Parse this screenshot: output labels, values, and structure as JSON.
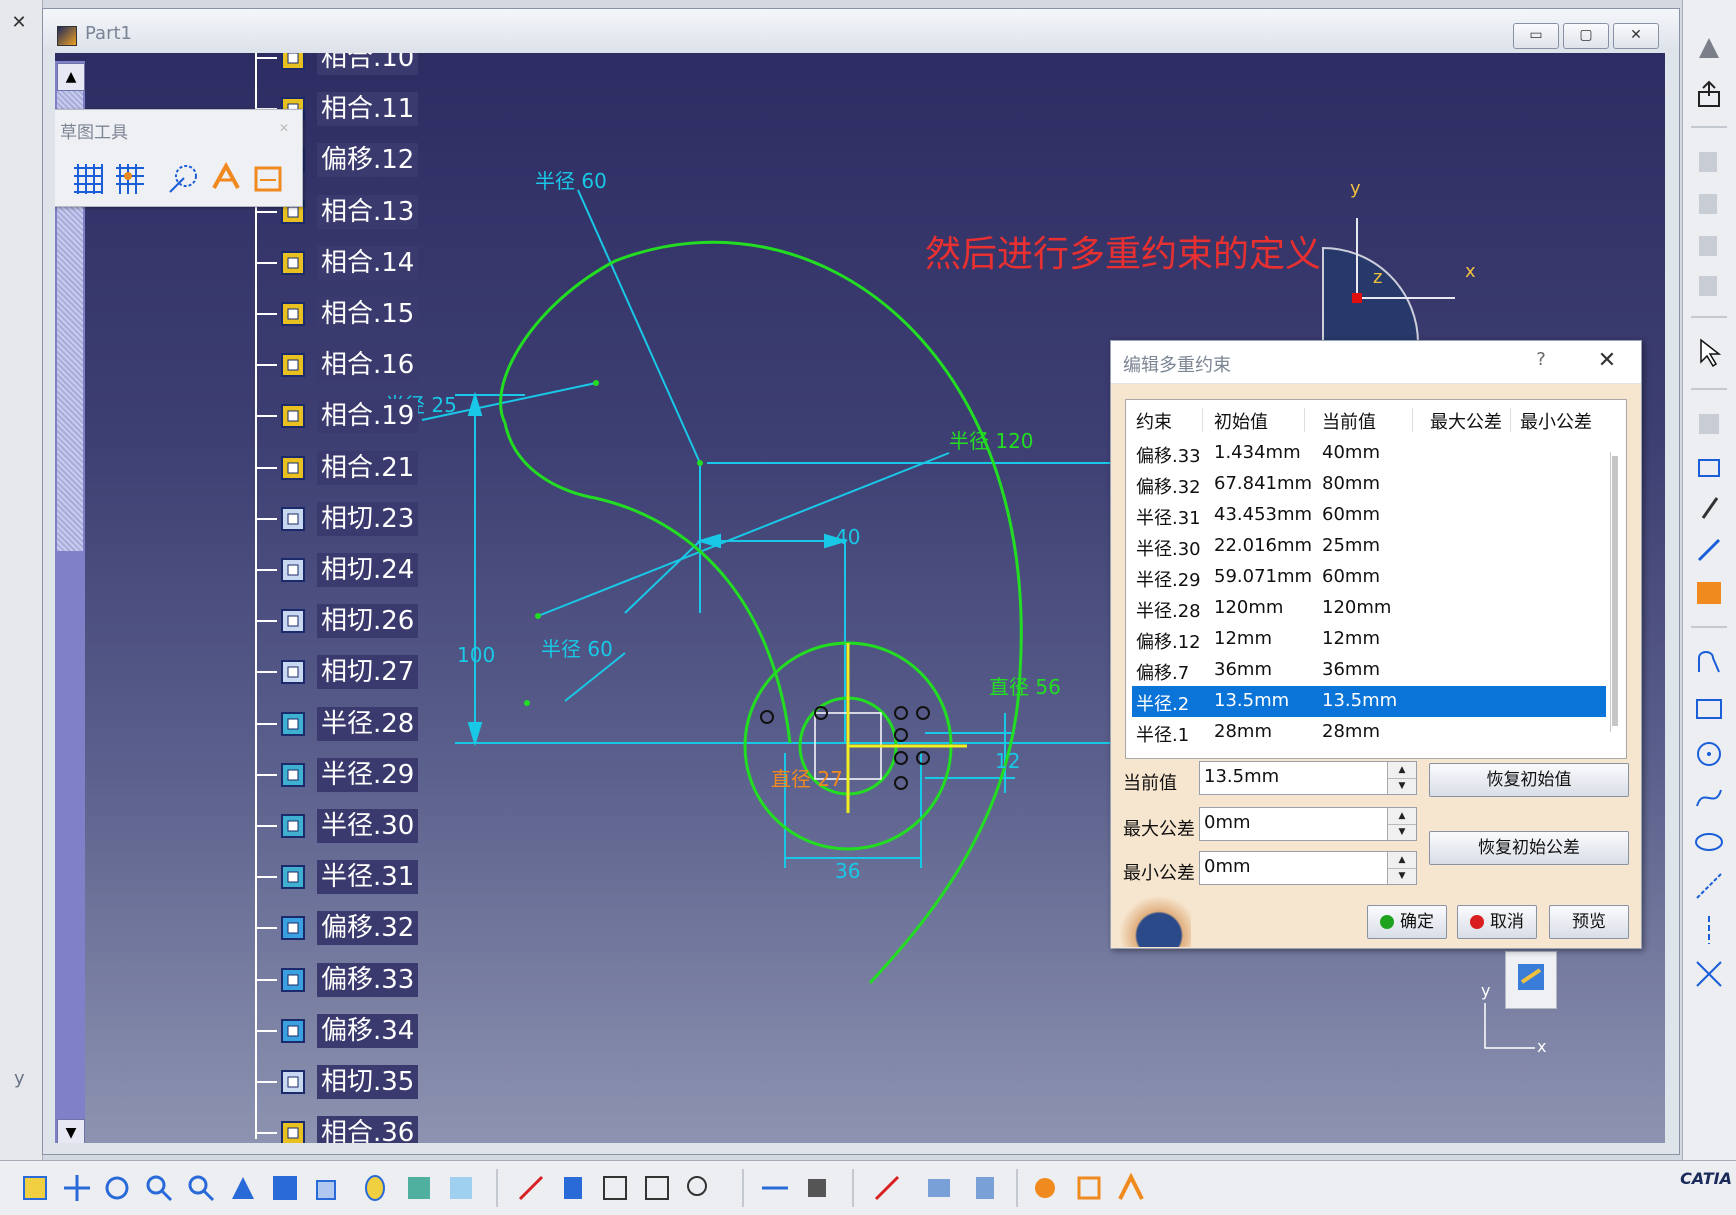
{
  "outer": {
    "close_glyph": "✕"
  },
  "window": {
    "title": "Part1",
    "minimize_glyph": "▭",
    "maximize_glyph": "▢",
    "close_glyph": "✕"
  },
  "tree": {
    "items": [
      {
        "label": "相合.10",
        "icon": "coincidence-icon"
      },
      {
        "label": "相合.11",
        "icon": "coincidence-icon"
      },
      {
        "label": "偏移.12",
        "icon": "offset-icon"
      },
      {
        "label": "相合.13",
        "icon": "coincidence-icon"
      },
      {
        "label": "相合.14",
        "icon": "coincidence-icon"
      },
      {
        "label": "相合.15",
        "icon": "coincidence-icon"
      },
      {
        "label": "相合.16",
        "icon": "coincidence-icon"
      },
      {
        "label": "相合.19",
        "icon": "coincidence-icon"
      },
      {
        "label": "相合.21",
        "icon": "coincidence-icon"
      },
      {
        "label": "相切.23",
        "icon": "tangency-icon"
      },
      {
        "label": "相切.24",
        "icon": "tangency-icon"
      },
      {
        "label": "相切.26",
        "icon": "tangency-icon"
      },
      {
        "label": "相切.27",
        "icon": "tangency-icon"
      },
      {
        "label": "半径.28",
        "icon": "radius-icon"
      },
      {
        "label": "半径.29",
        "icon": "radius-icon"
      },
      {
        "label": "半径.30",
        "icon": "radius-icon"
      },
      {
        "label": "半径.31",
        "icon": "radius-icon"
      },
      {
        "label": "偏移.32",
        "icon": "offset-icon"
      },
      {
        "label": "偏移.33",
        "icon": "offset-icon"
      },
      {
        "label": "偏移.34",
        "icon": "offset-icon"
      },
      {
        "label": "相切.35",
        "icon": "tangency-icon"
      },
      {
        "label": "相合.36",
        "icon": "coincidence-icon"
      }
    ],
    "scroll_up_glyph": "▲",
    "scroll_down_glyph": "▼"
  },
  "sketch_tools": {
    "title": "草图工具",
    "close_glyph": "✕",
    "buttons": [
      "grid-icon",
      "snap-to-point-icon",
      "construction-element-icon",
      "geometric-constraints-icon",
      "dimensional-constraints-icon"
    ]
  },
  "annotation": {
    "instruction": "然后进行多重约束的定义"
  },
  "sketch_labels": {
    "radius60_top": "半径 60",
    "radius25": "半径 25",
    "radius120": "半径 120",
    "dim40": "40",
    "dim100": "100",
    "radius60_mid": "半径 60",
    "diameter56": "直径 56",
    "diameter27": "直径 27",
    "dim12": "12",
    "dim36": "36"
  },
  "compass": {
    "x": "x",
    "y": "y",
    "z": "z"
  },
  "corner_axis": {
    "x": "x",
    "y": "y"
  },
  "outer_axis_y": "y",
  "dialog": {
    "title": "编辑多重约束",
    "help_glyph": "?",
    "close_glyph": "✕",
    "columns": [
      "约束",
      "初始值",
      "当前值",
      "最大公差",
      "最小公差"
    ],
    "rows": [
      {
        "constraint": "偏移.33",
        "initial": "1.434mm",
        "current": "40mm"
      },
      {
        "constraint": "偏移.32",
        "initial": "67.841mm",
        "current": "80mm"
      },
      {
        "constraint": "半径.31",
        "initial": "43.453mm",
        "current": "60mm"
      },
      {
        "constraint": "半径.30",
        "initial": "22.016mm",
        "current": "25mm"
      },
      {
        "constraint": "半径.29",
        "initial": "59.071mm",
        "current": "60mm"
      },
      {
        "constraint": "半径.28",
        "initial": "120mm",
        "current": "120mm"
      },
      {
        "constraint": "偏移.12",
        "initial": "12mm",
        "current": "12mm"
      },
      {
        "constraint": "偏移.7",
        "initial": "36mm",
        "current": "36mm"
      },
      {
        "constraint": "半径.2",
        "initial": "13.5mm",
        "current": "13.5mm",
        "selected": true
      },
      {
        "constraint": "半径.1",
        "initial": "28mm",
        "current": "28mm"
      }
    ],
    "current_value_label": "当前值",
    "current_value": "13.5mm",
    "max_tol_label": "最大公差",
    "max_tol": "0mm",
    "min_tol_label": "最小公差",
    "min_tol": "0mm",
    "restore_initial_value": "恢复初始值",
    "restore_initial_tolerance": "恢复初始公差",
    "ok": "确定",
    "cancel": "取消",
    "preview": "预览"
  },
  "brand": "CATIA",
  "colors": {
    "sketch_green": "#22dd22",
    "dimension_cyan": "#19c8e6",
    "instruction_red": "#e83030",
    "selection_blue": "#0a74d8",
    "dialog_bg": "#f7e6cf",
    "highlight_orange": "#f08a1e"
  }
}
